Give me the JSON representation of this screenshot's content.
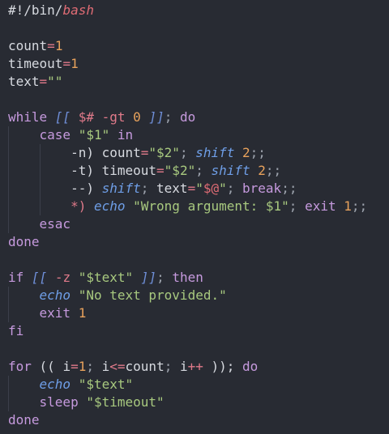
{
  "editor": {
    "lines": [
      [
        {
          "t": "#!/bin/",
          "c": "shebang"
        },
        {
          "t": "bash",
          "c": "bash"
        }
      ],
      [],
      [
        {
          "t": "count",
          "c": "var"
        },
        {
          "t": "=",
          "c": "op"
        },
        {
          "t": "1",
          "c": "num"
        }
      ],
      [
        {
          "t": "timeout",
          "c": "var"
        },
        {
          "t": "=",
          "c": "op"
        },
        {
          "t": "1",
          "c": "num"
        }
      ],
      [
        {
          "t": "text",
          "c": "var"
        },
        {
          "t": "=",
          "c": "op"
        },
        {
          "t": "\"\"",
          "c": "str"
        }
      ],
      [],
      [
        {
          "t": "while ",
          "c": "kw"
        },
        {
          "t": "[[",
          "c": "bracket"
        },
        {
          "t": " ",
          "c": "plain"
        },
        {
          "t": "$#",
          "c": "dollar"
        },
        {
          "t": " ",
          "c": "plain"
        },
        {
          "t": "-gt",
          "c": "op"
        },
        {
          "t": " ",
          "c": "plain"
        },
        {
          "t": "0",
          "c": "num"
        },
        {
          "t": " ",
          "c": "plain"
        },
        {
          "t": "]]",
          "c": "bracket"
        },
        {
          "t": "; ",
          "c": "punc"
        },
        {
          "t": "do",
          "c": "kw"
        }
      ],
      [
        {
          "t": "    ",
          "c": "plain",
          "g": [
            1
          ]
        },
        {
          "t": "case ",
          "c": "kw"
        },
        {
          "t": "\"$1\"",
          "c": "str"
        },
        {
          "t": " in",
          "c": "kw"
        }
      ],
      [
        {
          "t": "        ",
          "c": "plain",
          "g": [
            1,
            2
          ]
        },
        {
          "t": "-n) ",
          "c": "plain"
        },
        {
          "t": "count",
          "c": "var"
        },
        {
          "t": "=",
          "c": "op"
        },
        {
          "t": "\"$2\"",
          "c": "str"
        },
        {
          "t": "; ",
          "c": "punc"
        },
        {
          "t": "shift",
          "c": "builtin"
        },
        {
          "t": " ",
          "c": "plain"
        },
        {
          "t": "2",
          "c": "num"
        },
        {
          "t": ";;",
          "c": "punc"
        }
      ],
      [
        {
          "t": "        ",
          "c": "plain",
          "g": [
            1,
            2
          ]
        },
        {
          "t": "-t) ",
          "c": "plain"
        },
        {
          "t": "timeout",
          "c": "var"
        },
        {
          "t": "=",
          "c": "op"
        },
        {
          "t": "\"$2\"",
          "c": "str"
        },
        {
          "t": "; ",
          "c": "punc"
        },
        {
          "t": "shift",
          "c": "builtin"
        },
        {
          "t": " ",
          "c": "plain"
        },
        {
          "t": "2",
          "c": "num"
        },
        {
          "t": ";;",
          "c": "punc"
        }
      ],
      [
        {
          "t": "        ",
          "c": "plain",
          "g": [
            1,
            2
          ]
        },
        {
          "t": "--) ",
          "c": "plain"
        },
        {
          "t": "shift",
          "c": "builtin"
        },
        {
          "t": "; ",
          "c": "punc"
        },
        {
          "t": "text",
          "c": "var"
        },
        {
          "t": "=",
          "c": "op"
        },
        {
          "t": "\"",
          "c": "str"
        },
        {
          "t": "$@",
          "c": "atvar"
        },
        {
          "t": "\"",
          "c": "str"
        },
        {
          "t": "; ",
          "c": "punc"
        },
        {
          "t": "break",
          "c": "kw"
        },
        {
          "t": ";;",
          "c": "punc"
        }
      ],
      [
        {
          "t": "        ",
          "c": "plain",
          "g": [
            1,
            2
          ]
        },
        {
          "t": "*) ",
          "c": "op"
        },
        {
          "t": "echo",
          "c": "builtin"
        },
        {
          "t": " ",
          "c": "plain"
        },
        {
          "t": "\"Wrong argument: $1\"",
          "c": "str"
        },
        {
          "t": "; ",
          "c": "punc"
        },
        {
          "t": "exit ",
          "c": "kw"
        },
        {
          "t": "1",
          "c": "num"
        },
        {
          "t": ";;",
          "c": "punc"
        }
      ],
      [
        {
          "t": "    ",
          "c": "plain",
          "g": [
            1
          ]
        },
        {
          "t": "esac",
          "c": "kw"
        }
      ],
      [
        {
          "t": "done",
          "c": "kw"
        }
      ],
      [],
      [
        {
          "t": "if ",
          "c": "kw"
        },
        {
          "t": "[[",
          "c": "bracket"
        },
        {
          "t": " ",
          "c": "plain"
        },
        {
          "t": "-z",
          "c": "op"
        },
        {
          "t": " ",
          "c": "plain"
        },
        {
          "t": "\"$text\"",
          "c": "str"
        },
        {
          "t": " ",
          "c": "plain"
        },
        {
          "t": "]]",
          "c": "bracket"
        },
        {
          "t": "; ",
          "c": "punc"
        },
        {
          "t": "then",
          "c": "kw"
        }
      ],
      [
        {
          "t": "    ",
          "c": "plain",
          "g": [
            1
          ]
        },
        {
          "t": "echo",
          "c": "builtin"
        },
        {
          "t": " ",
          "c": "plain"
        },
        {
          "t": "\"No text provided.\"",
          "c": "str"
        }
      ],
      [
        {
          "t": "    ",
          "c": "plain",
          "g": [
            1
          ]
        },
        {
          "t": "exit ",
          "c": "kw"
        },
        {
          "t": "1",
          "c": "num"
        }
      ],
      [
        {
          "t": "fi",
          "c": "kw"
        }
      ],
      [],
      [
        {
          "t": "for ",
          "c": "kw"
        },
        {
          "t": "(( ",
          "c": "plain"
        },
        {
          "t": "i",
          "c": "var"
        },
        {
          "t": "=",
          "c": "op"
        },
        {
          "t": "1",
          "c": "num"
        },
        {
          "t": "; ",
          "c": "punc"
        },
        {
          "t": "i",
          "c": "var"
        },
        {
          "t": "<=",
          "c": "op"
        },
        {
          "t": "count",
          "c": "var"
        },
        {
          "t": "; ",
          "c": "punc"
        },
        {
          "t": "i",
          "c": "var"
        },
        {
          "t": "++",
          "c": "op"
        },
        {
          "t": " )); ",
          "c": "plain"
        },
        {
          "t": "do",
          "c": "kw"
        }
      ],
      [
        {
          "t": "    ",
          "c": "plain",
          "g": [
            1
          ]
        },
        {
          "t": "echo",
          "c": "builtin"
        },
        {
          "t": " ",
          "c": "plain"
        },
        {
          "t": "\"$text\"",
          "c": "str"
        }
      ],
      [
        {
          "t": "    ",
          "c": "plain",
          "g": [
            1
          ]
        },
        {
          "t": "sleep ",
          "c": "kw"
        },
        {
          "t": "\"$timeout\"",
          "c": "str"
        }
      ],
      [
        {
          "t": "done",
          "c": "kw"
        }
      ]
    ]
  },
  "theme": {
    "background": "#282b33",
    "foreground": "#d7dae0",
    "keyword": "#c69ade",
    "string": "#a8c97f",
    "number": "#e8a25c",
    "operator": "#e07a8a",
    "builtin": "#6f9fe8",
    "bracket": "#6f8fd8",
    "indent_guide": "#3b3f4a"
  }
}
